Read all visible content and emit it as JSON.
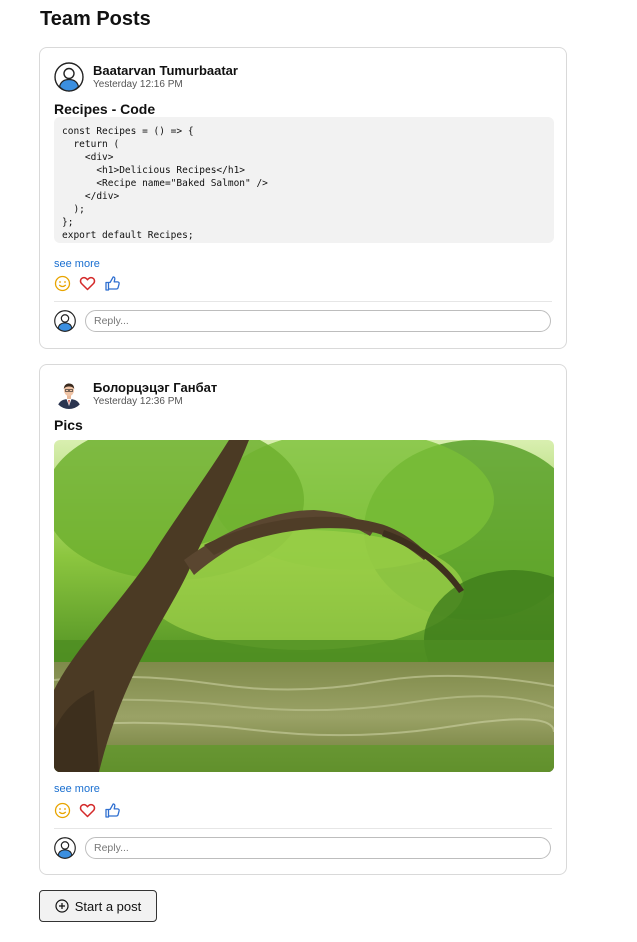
{
  "page": {
    "title": "Team Posts"
  },
  "posts": [
    {
      "author": "Baatarvan Tumurbaatar",
      "time": "Yesterday 12:16 PM",
      "title": "Recipes - Code",
      "code_lines": [
        "const Recipes = () => {",
        "  return (",
        "    <div>",
        "      <h1>Delicious Recipes</h1>",
        "      <Recipe name=\"Baked Salmon\" />",
        "    </div>",
        "  );",
        "};",
        "export default Recipes;"
      ],
      "see_more": "see more",
      "reply_placeholder": "Reply..."
    },
    {
      "author": "Болорцэцэг Ганбат",
      "time": "Yesterday 12:36 PM",
      "title": "Pics",
      "see_more": "see more",
      "reply_placeholder": "Reply..."
    }
  ],
  "actions": {
    "start_post_label": "Start a post"
  },
  "colors": {
    "link": "#1a6fd0",
    "smile": "#e8a400",
    "heart": "#d42a2a",
    "like": "#2f6fd0",
    "avatar_blue": "#3b8fe0"
  },
  "icons": [
    "user-avatar-icon",
    "smile-icon",
    "heart-icon",
    "thumbs-up-icon",
    "plus-circle-icon"
  ]
}
